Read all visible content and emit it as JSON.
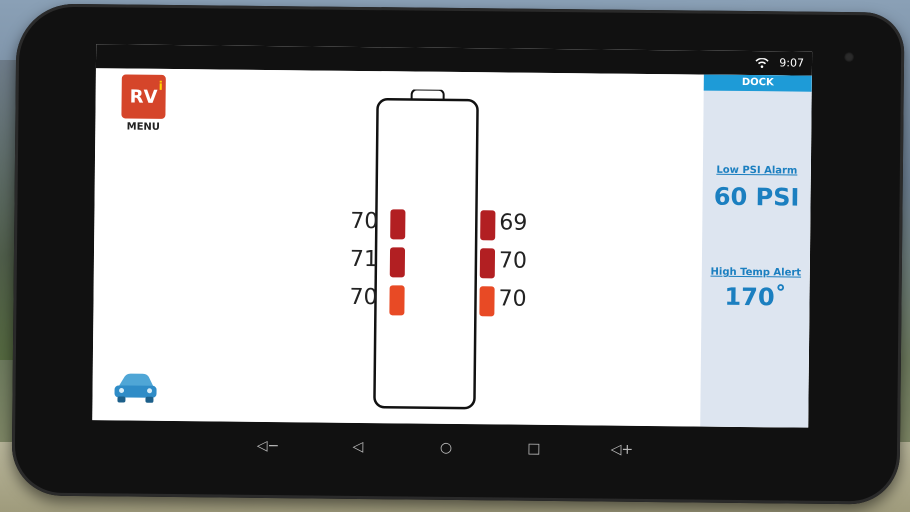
{
  "status": {
    "time": "9:07",
    "wifi_icon": "wifi-icon"
  },
  "app": {
    "logo_text": "RV",
    "logo_accent": "i",
    "menu_label": "MENU",
    "dock_label": "DOCK",
    "low_psi": {
      "label": "Low PSI Alarm",
      "value": "60 PSI"
    },
    "high_temp": {
      "label": "High Temp Alert",
      "value": "170˚"
    },
    "tires": {
      "left": [
        {
          "psi": "70",
          "status_color": "#b21f22"
        },
        {
          "psi": "71",
          "status_color": "#b21f22"
        },
        {
          "psi": "70",
          "status_color": "#e84a25"
        }
      ],
      "right": [
        {
          "psi": "69",
          "status_color": "#b21f22"
        },
        {
          "psi": "70",
          "status_color": "#b21f22"
        },
        {
          "psi": "70",
          "status_color": "#e84a25"
        }
      ]
    },
    "car_icon": "car-icon"
  },
  "navbar": [
    "volume-down-icon",
    "back-icon",
    "home-icon",
    "recents-icon",
    "volume-up-icon"
  ],
  "colors": {
    "accent": "#1e9bd7",
    "panel": "#dde5f0",
    "logo": "#d5452a"
  }
}
